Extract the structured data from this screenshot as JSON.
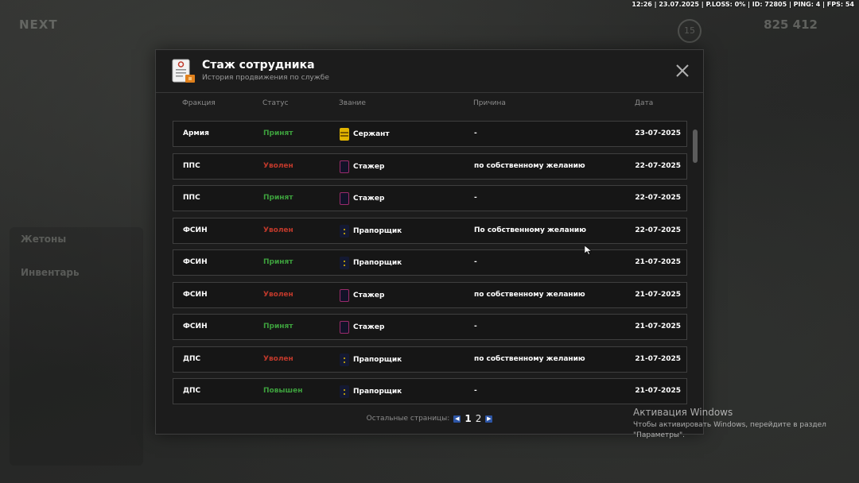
{
  "status_bar": "12:26 | 23.07.2025 | P.LOSS: 0% | ID: 72805 | PING: 4 | FPS: 54",
  "modal": {
    "title": "Стаж сотрудника",
    "subtitle": "История продвижения по службе",
    "close_icon": "close-icon"
  },
  "columns": {
    "faction": "Фракция",
    "status": "Статус",
    "rank": "Звание",
    "reason": "Причина",
    "date": "Дата"
  },
  "rows": [
    {
      "faction": "Армия",
      "status": "Принят",
      "status_color": "#3da03d",
      "rank": "Сержант",
      "rank_icon": "sergeant-rank-icon",
      "reason": "-",
      "date": "23-07-2025"
    },
    {
      "faction": "ППС",
      "status": "Уволен",
      "status_color": "#c0392b",
      "rank": "Стажер",
      "rank_icon": "trainee-rank-icon",
      "reason": "по собственному желанию",
      "date": "22-07-2025"
    },
    {
      "faction": "ППС",
      "status": "Принят",
      "status_color": "#3da03d",
      "rank": "Стажер",
      "rank_icon": "trainee-rank-icon",
      "reason": "-",
      "date": "22-07-2025"
    },
    {
      "faction": "ФСИН",
      "status": "Уволен",
      "status_color": "#c0392b",
      "rank": "Прапорщик",
      "rank_icon": "ensign-rank-icon",
      "reason": "По собственному желанию",
      "date": "22-07-2025"
    },
    {
      "faction": "ФСИН",
      "status": "Принят",
      "status_color": "#3da03d",
      "rank": "Прапорщик",
      "rank_icon": "ensign-rank-icon",
      "reason": "-",
      "date": "21-07-2025"
    },
    {
      "faction": "ФСИН",
      "status": "Уволен",
      "status_color": "#c0392b",
      "rank": "Стажер",
      "rank_icon": "trainee-rank-icon",
      "reason": "по собственному желанию",
      "date": "21-07-2025"
    },
    {
      "faction": "ФСИН",
      "status": "Принят",
      "status_color": "#3da03d",
      "rank": "Стажер",
      "rank_icon": "trainee-rank-icon",
      "reason": "-",
      "date": "21-07-2025"
    },
    {
      "faction": "ДПС",
      "status": "Уволен",
      "status_color": "#c0392b",
      "rank": "Прапорщик",
      "rank_icon": "ensign-rank-icon",
      "reason": "по собственному желанию",
      "date": "21-07-2025"
    },
    {
      "faction": "ДПС",
      "status": "Повышен",
      "status_color": "#3da03d",
      "rank": "Прапорщик",
      "rank_icon": "ensign-rank-icon",
      "reason": "-",
      "date": "21-07-2025"
    }
  ],
  "pagination": {
    "label": "Остальные страницы:",
    "pages": [
      "1",
      "2"
    ],
    "current": "1",
    "prev_icon": "chevron-left-icon",
    "next_icon": "chevron-right-icon"
  },
  "windows_watermark": {
    "title": "Активация Windows",
    "text": "Чтобы активировать Windows, перейдите в раздел \"Параметры\"."
  },
  "background": {
    "logo": "NEXT",
    "money": "825 412",
    "ring_value": "15",
    "panel_title_1": "Жетоны",
    "panel_title_2": "Инвентарь"
  }
}
